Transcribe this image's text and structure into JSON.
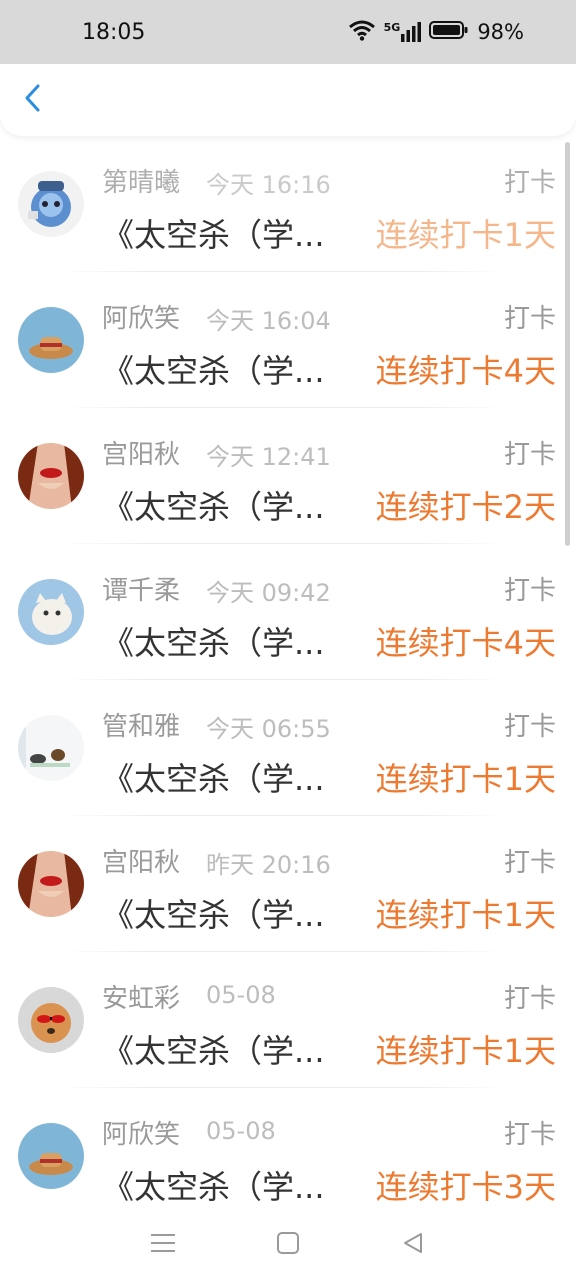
{
  "status_bar": {
    "time": "18:05",
    "network": "5G",
    "battery": "98%"
  },
  "header": {
    "back_icon": "chevron-left-icon",
    "accent": "#2a8de0"
  },
  "list": {
    "items": [
      {
        "name": "第晴曦",
        "time": "今天 16:16",
        "action": "打卡",
        "title": "《太空杀（学...",
        "streak": "连续打卡1天",
        "avatar": "astronaut-cartoon",
        "faded": true
      },
      {
        "name": "阿欣笑",
        "time": "今天 16:04",
        "action": "打卡",
        "title": "《太空杀（学...",
        "streak": "连续打卡4天",
        "avatar": "straw-hat",
        "faded": false
      },
      {
        "name": "宫阳秋",
        "time": "今天 12:41",
        "action": "打卡",
        "title": "《太空杀（学...",
        "streak": "连续打卡2天",
        "avatar": "red-lips",
        "faded": false
      },
      {
        "name": "谭千柔",
        "time": "今天 09:42",
        "action": "打卡",
        "title": "《太空杀（学...",
        "streak": "连续打卡4天",
        "avatar": "white-cat",
        "faded": false
      },
      {
        "name": "管和雅",
        "time": "今天 06:55",
        "action": "打卡",
        "title": "《太空杀（学...",
        "streak": "连续打卡1天",
        "avatar": "sleeping-kids",
        "faded": false
      },
      {
        "name": "宫阳秋",
        "time": "昨天 20:16",
        "action": "打卡",
        "title": "《太空杀（学...",
        "streak": "连续打卡1天",
        "avatar": "red-lips",
        "faded": false
      },
      {
        "name": "安虹彩",
        "time": "05-08",
        "action": "打卡",
        "title": "《太空杀（学...",
        "streak": "连续打卡1天",
        "avatar": "dog-sunglasses",
        "faded": false
      },
      {
        "name": "阿欣笑",
        "time": "05-08",
        "action": "打卡",
        "title": "《太空杀（学...",
        "streak": "连续打卡3天",
        "avatar": "straw-hat",
        "faded": false
      }
    ]
  },
  "colors": {
    "streak": "#ee7a32",
    "name": "#9a9a9a",
    "title": "#333333",
    "status_bar_bg": "#d9d9d9"
  },
  "nav_bar": {
    "icons": [
      "menu-icon",
      "home-square-icon",
      "back-triangle-icon"
    ]
  }
}
